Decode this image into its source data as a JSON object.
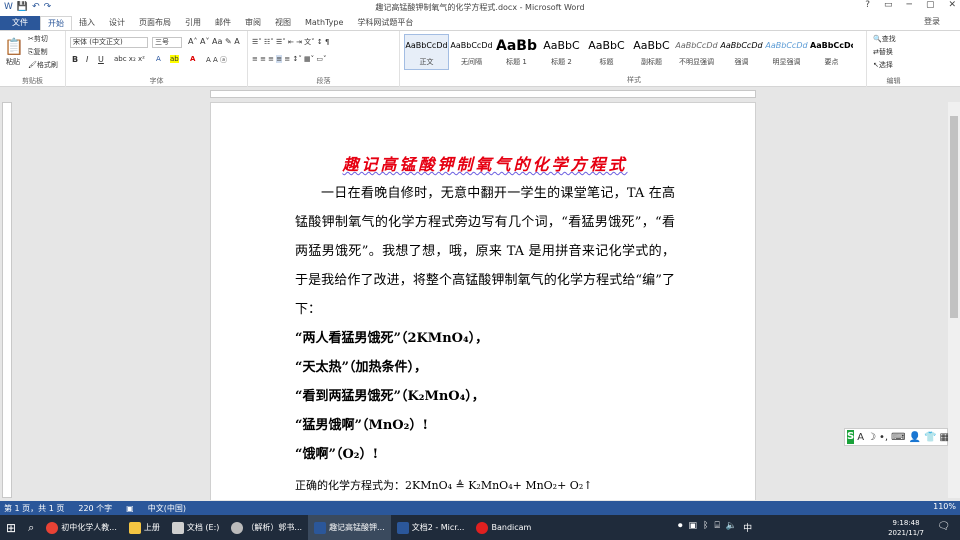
{
  "window": {
    "title": "趣记高锰酸钾制氧气的化学方程式.docx - Microsoft Word",
    "controls": [
      "?",
      "▭",
      "─",
      "▢",
      "✕"
    ]
  },
  "qat": {
    "save": "💾",
    "undo": "↶",
    "redo": "↷"
  },
  "tabs": [
    "文件",
    "开始",
    "插入",
    "设计",
    "页面布局",
    "引用",
    "邮件",
    "审阅",
    "视图",
    "MathType",
    "学科网试题平台"
  ],
  "login_label": "登录",
  "ribbon": {
    "clipboard": {
      "paste": "粘贴",
      "cut": "剪切",
      "copy": "复制",
      "format_painter": "格式刷",
      "label": "剪贴板"
    },
    "font": {
      "name": "宋体 (中文正文)",
      "size": "三号",
      "label": "字体"
    },
    "paragraph": {
      "label": "段落"
    },
    "styles": {
      "label": "样式",
      "items": [
        {
          "sample": "AaBbCcDd",
          "name": "正文"
        },
        {
          "sample": "AaBbCcDd",
          "name": "无间隔"
        },
        {
          "sample": "AaBb",
          "name": "标题 1"
        },
        {
          "sample": "AaBbC",
          "name": "标题 2"
        },
        {
          "sample": "AaBbC",
          "name": "标题"
        },
        {
          "sample": "AaBbC",
          "name": "副标题"
        },
        {
          "sample": "AaBbCcDd",
          "name": "不明显强调"
        },
        {
          "sample": "AaBbCcDd",
          "name": "强调"
        },
        {
          "sample": "AaBbCcDd",
          "name": "明显强调"
        },
        {
          "sample": "AaBbCcDc",
          "name": "要点"
        }
      ]
    },
    "editing": {
      "find": "查找",
      "replace": "替换",
      "select": "选择",
      "label": "编辑"
    }
  },
  "document": {
    "title": "趣记高锰酸钾制氧气的化学方程式",
    "paragraph": "一日在看晚自修时，无意中翻开一学生的课堂笔记，TA 在高锰酸钾制氧气的化学方程式旁边写有几个词，“看猛男饿死”，“看两猛男饿死”。我想了想，哦，原来 TA 是用拼音来记化学式的，于是我给作了改进，将整个高锰酸钾制氧气的化学方程式给“编”了下：",
    "lines": [
      "“两人看猛男饿死”（2KMnO₄），",
      "“天太热”（加热条件），",
      "“看到两猛男饿死”（K₂MnO₄），",
      "“猛男饿啊”（MnO₂）!",
      "“饿啊”（O₂）!"
    ],
    "equation": "正确的化学方程式为：2KMnO₄ ≜ K₂MnO₄+ MnO₂+ O₂↑"
  },
  "status": {
    "page": "第 1 页，共 1 页",
    "words": "220 个字",
    "lang": "中文(中国)",
    "zoom": "110%"
  },
  "taskbar": {
    "items": [
      {
        "label": "初中化学人教...",
        "color": "#e94235"
      },
      {
        "label": "上册",
        "color": "#f5c542"
      },
      {
        "label": "文档 (E:)",
        "color": "#cfcfcf"
      },
      {
        "label": "（解析）郭书...",
        "color": "#bbbbbb"
      },
      {
        "label": "趣记高锰酸钾...",
        "color": "#2b579a"
      },
      {
        "label": "文档2 - Micr...",
        "color": "#2b579a"
      },
      {
        "label": "Bandicam",
        "color": "#e02020"
      }
    ],
    "time": "9:18:48",
    "date": "2021/11/7"
  }
}
